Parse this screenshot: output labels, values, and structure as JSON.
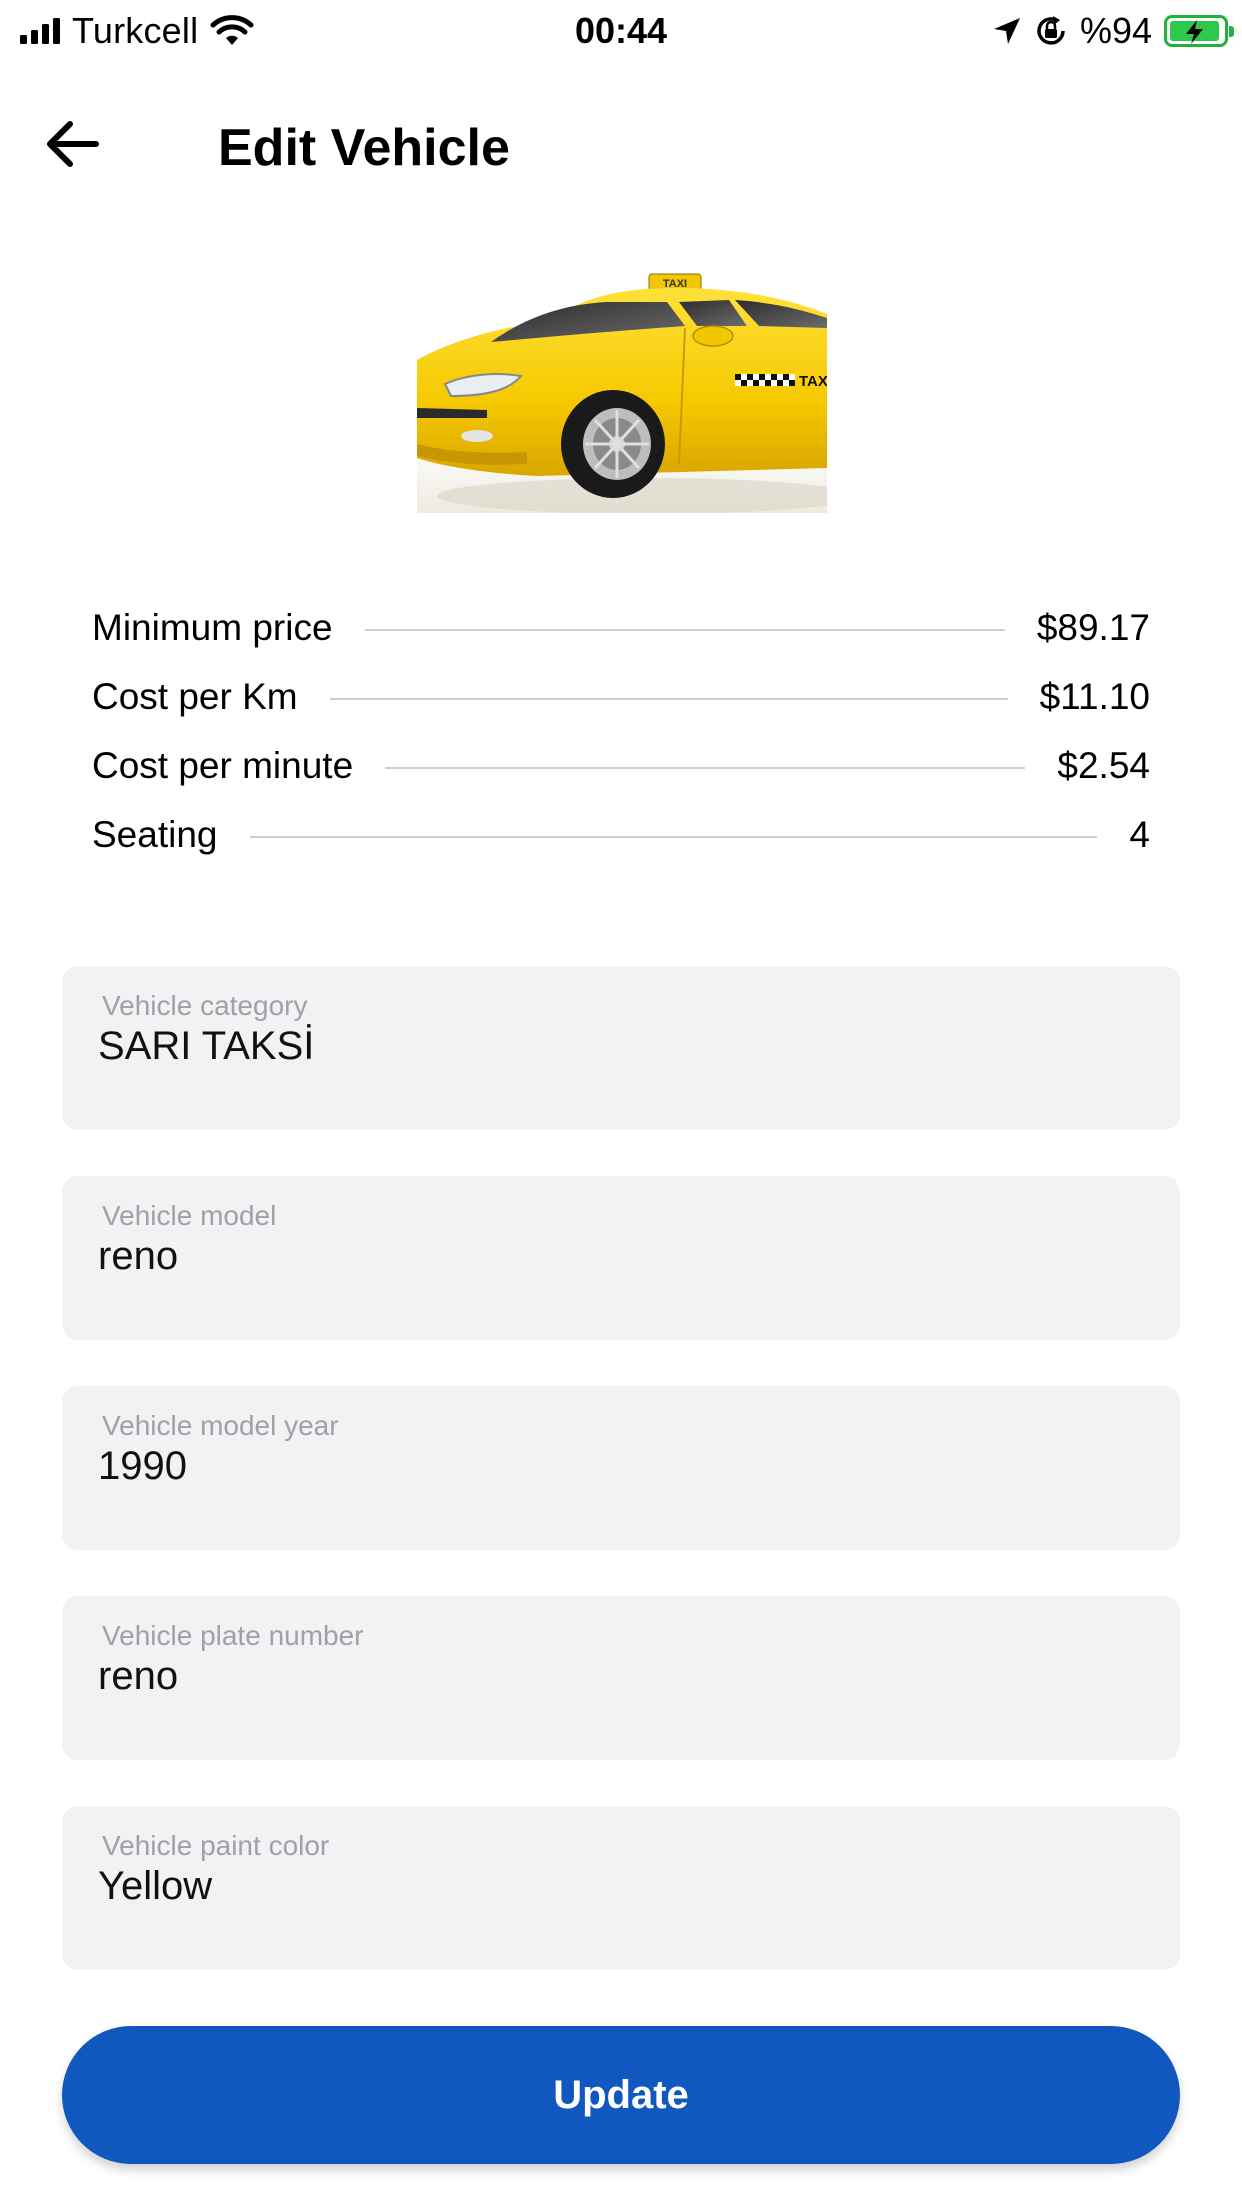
{
  "status_bar": {
    "carrier": "Turkcell",
    "time": "00:44",
    "battery_percent": "%94",
    "battery_color": "#2ec94a",
    "icons": [
      "signal-icon",
      "wifi-icon",
      "location-arrow-icon",
      "orientation-lock-icon",
      "battery-charging-icon"
    ]
  },
  "header": {
    "title": "Edit Vehicle",
    "back_icon": "arrow-left-icon"
  },
  "vehicle": {
    "image_alt": "yellow-taxi-car",
    "roof_sign": "TAXI",
    "door_text": "TAX"
  },
  "pricing": [
    {
      "label": "Minimum price",
      "value": "$89.17"
    },
    {
      "label": "Cost per Km",
      "value": "$11.10"
    },
    {
      "label": "Cost per minute",
      "value": "$2.54"
    },
    {
      "label": "Seating",
      "value": "4"
    }
  ],
  "form": {
    "fields": [
      {
        "label": "Vehicle category",
        "value": "SARI TAKSİ"
      },
      {
        "label": "Vehicle model",
        "value": "reno"
      },
      {
        "label": "Vehicle model year",
        "value": "1990"
      },
      {
        "label": "Vehicle plate number",
        "value": "reno"
      },
      {
        "label": "Vehicle paint color",
        "value": "Yellow"
      }
    ]
  },
  "update_button": {
    "label": "Update",
    "color": "#1157c0"
  }
}
